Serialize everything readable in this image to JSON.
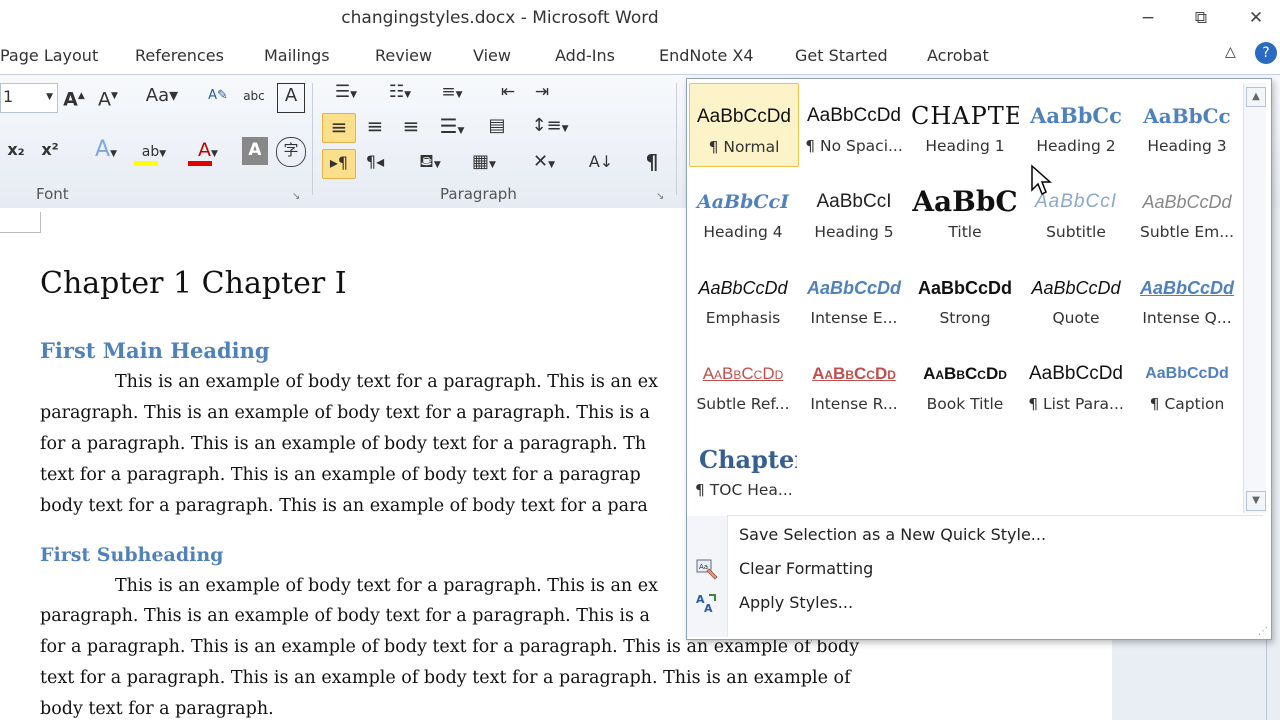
{
  "window": {
    "title": "changingstyles.docx - Microsoft Word",
    "minimize": "−",
    "restore": "⧉",
    "close": "✕"
  },
  "tabs": [
    "Page Layout",
    "References",
    "Mailings",
    "Review",
    "View",
    "Add-Ins",
    "EndNote X4",
    "Get Started",
    "Acrobat"
  ],
  "ribbon": {
    "font_size": "1",
    "font_group": "Font",
    "paragraph_group": "Paragraph"
  },
  "document": {
    "chapter_title": "Chapter 1  Chapter I",
    "heading1": "First Main Heading",
    "para1": [
      "This is an example of body text for a paragraph.  This is an ex",
      "paragraph.  This is an example of body text for a paragraph.  This is a",
      "for a paragraph.  This is an example of body text for a paragraph.  Th",
      "text for a paragraph.  This is an example of body text for a paragrap",
      "body text for a paragraph.  This is an example of body text for a para"
    ],
    "heading2": "First Subheading",
    "para2": [
      "This is an example of body text for a paragraph.  This is an ex",
      "paragraph.  This is an example of body text for a paragraph.  This is a",
      "for a paragraph.  This is an example of body text for a paragraph.  This is an example of body",
      "text for a paragraph.  This is an example of body text for a paragraph.  This is an example of",
      "body text for a paragraph."
    ]
  },
  "styles_gallery": {
    "styles": [
      {
        "sample": "AaBbCcDd",
        "name": "¶ Normal",
        "selected": true
      },
      {
        "sample": "AaBbCcDd",
        "name": "¶ No Spaci..."
      },
      {
        "sample": "CHAPTER",
        "name": "Heading 1"
      },
      {
        "sample": "AaBbCc",
        "name": "Heading 2"
      },
      {
        "sample": "AaBbCc",
        "name": "Heading 3"
      },
      {
        "sample": "AaBbCcI",
        "name": "Heading 4"
      },
      {
        "sample": "AaBbCcI",
        "name": "Heading 5"
      },
      {
        "sample": "AaBbC",
        "name": "Title"
      },
      {
        "sample": "AaBbCcI",
        "name": "Subtitle"
      },
      {
        "sample": "AaBbCcDd",
        "name": "Subtle Em..."
      },
      {
        "sample": "AaBbCcDd",
        "name": "Emphasis"
      },
      {
        "sample": "AaBbCcDd",
        "name": "Intense E..."
      },
      {
        "sample": "AaBbCcDd",
        "name": "Strong"
      },
      {
        "sample": "AaBbCcDd",
        "name": "Quote"
      },
      {
        "sample": "AaBbCcDd",
        "name": "Intense Q..."
      },
      {
        "sample": "AaBbCcDd",
        "name": "Subtle Ref..."
      },
      {
        "sample": "AaBbCcDd",
        "name": "Intense R..."
      },
      {
        "sample": "AaBbCcDd",
        "name": "Book Title"
      },
      {
        "sample": "AaBbCcDd",
        "name": "¶ List Para..."
      },
      {
        "sample": "AaBbCcDd",
        "name": "¶ Caption"
      },
      {
        "sample": "Chapter",
        "name": "¶ TOC Hea..."
      }
    ],
    "menu": {
      "save_selection": "Save Selection as a New Quick Style...",
      "clear_formatting": "Clear Formatting",
      "apply_styles": "Apply Styles..."
    }
  },
  "colors": {
    "heading_blue": "#4f81bd",
    "selection_gold": "#fcdf8a",
    "ribbon_bg": "#e6ebf3"
  }
}
